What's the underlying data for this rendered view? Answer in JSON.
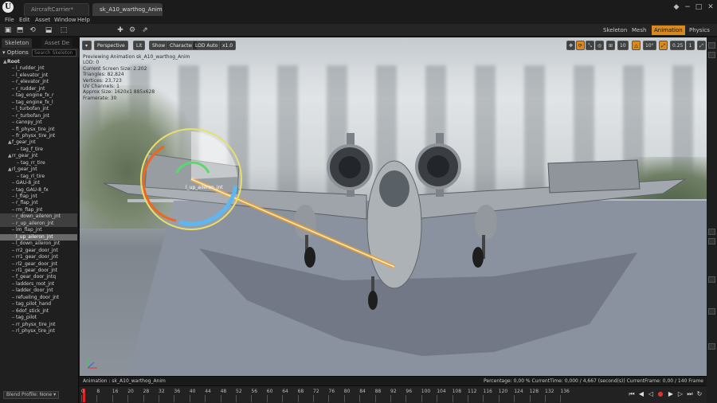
{
  "window": {
    "tabs": [
      {
        "label": "AircraftCarrier*",
        "active": false
      },
      {
        "label": "sk_A10_warthog_Anim",
        "active": true
      }
    ]
  },
  "menu": [
    "File",
    "Edit",
    "Asset",
    "Window",
    "Help"
  ],
  "modes": [
    {
      "label": "Skeleton",
      "active": false
    },
    {
      "label": "Mesh",
      "active": false
    },
    {
      "label": "Animation",
      "active": true
    },
    {
      "label": "Physics",
      "active": false
    }
  ],
  "left_panel": {
    "tabs": [
      "Skeleton",
      "Asset De"
    ],
    "options_label": "Options",
    "search_placeholder": "Search Skeleton",
    "blend_profile": "Blend Profile: None",
    "bones": [
      {
        "label": "Root",
        "indent": 0,
        "twist": "▲"
      },
      {
        "label": "l_rudder_jnt",
        "indent": 1
      },
      {
        "label": "l_elevator_jnt",
        "indent": 1
      },
      {
        "label": "r_elevator_jnt",
        "indent": 1
      },
      {
        "label": "r_rudder_jnt",
        "indent": 1
      },
      {
        "label": "tag_engine_fx_r",
        "indent": 1
      },
      {
        "label": "tag_engine_fx_l",
        "indent": 1
      },
      {
        "label": "l_turbofan_jnt",
        "indent": 1
      },
      {
        "label": "r_turbofan_jnt",
        "indent": 1
      },
      {
        "label": "canopy_jnt",
        "indent": 1
      },
      {
        "label": "fl_physx_tire_jnt",
        "indent": 1
      },
      {
        "label": "fr_physx_tire_jnt",
        "indent": 1
      },
      {
        "label": "f_gear_jnt",
        "indent": 1,
        "twist": "▲"
      },
      {
        "label": "tag_f_tire",
        "indent": 2
      },
      {
        "label": "rr_gear_jnt",
        "indent": 1,
        "twist": "▲"
      },
      {
        "label": "tag_rr_tire",
        "indent": 2
      },
      {
        "label": "rl_gear_jnt",
        "indent": 1,
        "twist": "▲"
      },
      {
        "label": "tag_rl_tire",
        "indent": 2
      },
      {
        "label": "GAU-8_jnt",
        "indent": 1
      },
      {
        "label": "tag_GAU-8_fx",
        "indent": 1
      },
      {
        "label": "l_flap_jnt",
        "indent": 1
      },
      {
        "label": "r_flap_jnt",
        "indent": 1
      },
      {
        "label": "rm_flap_jnt",
        "indent": 1
      },
      {
        "label": "r_down_aileron_jnt",
        "indent": 1,
        "state": "hl"
      },
      {
        "label": "r_up_aileron_jnt",
        "indent": 1,
        "state": "hl"
      },
      {
        "label": "lm_flap_jnt",
        "indent": 1
      },
      {
        "label": "l_up_aileron_jnt",
        "indent": 1,
        "state": "sel"
      },
      {
        "label": "l_down_aileron_jnt",
        "indent": 1
      },
      {
        "label": "rr2_gear_door_jnt",
        "indent": 1
      },
      {
        "label": "rr1_gear_door_jnt",
        "indent": 1
      },
      {
        "label": "rl2_gear_door_jnt",
        "indent": 1
      },
      {
        "label": "rl1_gear_door_jnt",
        "indent": 1
      },
      {
        "label": "f_gear_door_jntq",
        "indent": 1
      },
      {
        "label": "ladders_root_jnt",
        "indent": 1
      },
      {
        "label": "ladder_door_jnt",
        "indent": 1
      },
      {
        "label": "refueling_door_jnt",
        "indent": 1
      },
      {
        "label": "tag_pilot_hand",
        "indent": 1
      },
      {
        "label": "6dof_stick_jnt",
        "indent": 1
      },
      {
        "label": "tag_pilot",
        "indent": 1
      },
      {
        "label": "rr_physx_tire_jnt",
        "indent": 1
      },
      {
        "label": "rl_physx_tire_jnt",
        "indent": 1
      }
    ]
  },
  "viewport": {
    "toolbar": [
      "Perspective",
      "Lit",
      "Show",
      "Character",
      "LOD Auto",
      "x1.0"
    ],
    "stats": [
      "Previewing Animation sk_A10_warthog_Anim",
      "LOD: 0",
      "Current Screen Size: 2.202",
      "Triangles: 82,824",
      "Vertices: 23,723",
      "UV Channels: 1",
      "Approx Size: 1620x1 885x628",
      "Framerate: 30"
    ],
    "right_tools": [
      "10",
      "10°",
      "0.25",
      "1"
    ],
    "gizmo_label": "l_up_aileron_jnt"
  },
  "anim_bar": {
    "left": "Animation : sk_A10_warthog_Anim",
    "right": "Percentage:  0,00 %  CurrentTime: 0,000 / 4,667 (second(s))  CurrentFrame: 0,00 / 140 Frame"
  },
  "timeline": {
    "ticks": [
      "0",
      "8",
      "16",
      "20",
      "28",
      "32",
      "36",
      "40",
      "44",
      "48",
      "52",
      "56",
      "60",
      "64",
      "68",
      "72",
      "76",
      "80",
      "84",
      "88",
      "92",
      "96",
      "100",
      "104",
      "108",
      "112",
      "116",
      "120",
      "124",
      "128",
      "132",
      "136"
    ]
  },
  "colors": {
    "accent": "#d88a1f",
    "selection": "#6a6a6a"
  }
}
